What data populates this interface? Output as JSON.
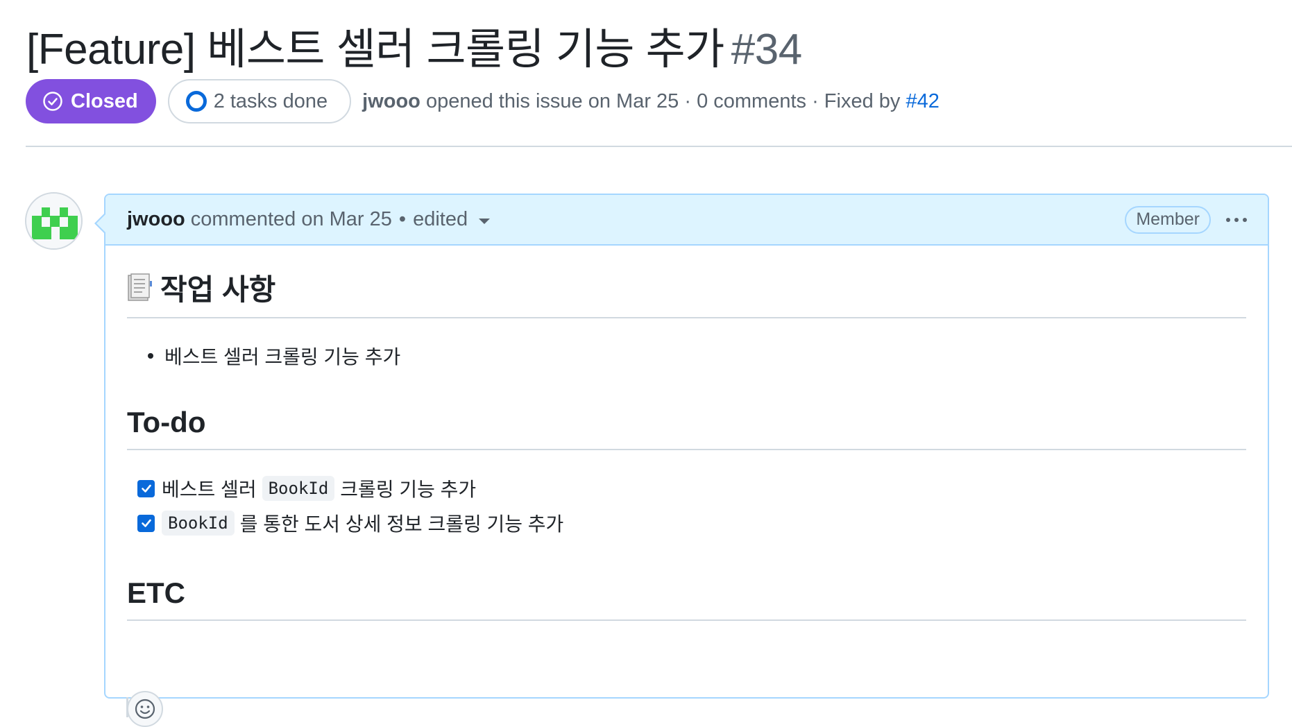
{
  "issue": {
    "title": "[Feature] 베스트 셀러 크롤링 기능 추가",
    "number": "#34",
    "state": "Closed",
    "tasks": "2 tasks done",
    "author": "jwooo",
    "opened_text": "opened this issue on Mar 25 · 0 comments · Fixed by",
    "fixed_by": "#42"
  },
  "comment": {
    "author": "jwooo",
    "action": "commented on Mar 25",
    "separator": "•",
    "edited": "edited",
    "role_badge": "Member",
    "sections": {
      "work_heading": "작업 사항",
      "work_items": [
        "베스트 셀러 크롤링 기능 추가"
      ],
      "todo_heading": "To-do",
      "todo_items": [
        {
          "checked": true,
          "prefix": "베스트 셀러",
          "code": "BookId",
          "suffix": "크롤링 기능 추가"
        },
        {
          "checked": true,
          "prefix": "",
          "code": "BookId",
          "suffix": "를 통한 도서 상세 정보 크롤링 기능 추가"
        }
      ],
      "etc_heading": "ETC"
    }
  },
  "colors": {
    "closed_badge": "#8250df",
    "link": "#0969da",
    "header_bg": "#ddf4ff",
    "header_border": "#a5d6ff",
    "avatar_green": "#3fcf4f"
  },
  "icons": [
    "check-circle-icon",
    "progress-ring-icon",
    "doc-icon",
    "caret-down-icon",
    "kebab-icon",
    "checkbox-icon",
    "smiley-icon"
  ]
}
